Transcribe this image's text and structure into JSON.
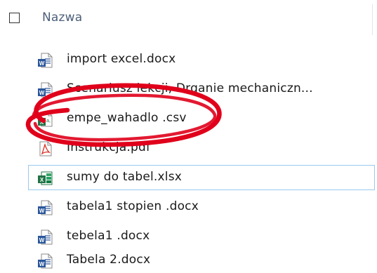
{
  "header": {
    "column_label": "Nazwa"
  },
  "files": [
    {
      "name": "import excel.docx",
      "icon": "word-document-icon",
      "type": "word"
    },
    {
      "name": "Scenariusz lekcji, Drganie mechaniczn...",
      "icon": "word-document-icon",
      "type": "word"
    },
    {
      "name": "empe_wahadlo .csv",
      "icon": "excel-csv-icon",
      "type": "csv"
    },
    {
      "name": "Instrukcja.pdf",
      "icon": "pdf-document-icon",
      "type": "pdf"
    },
    {
      "name": "sumy do tabel.xlsx",
      "icon": "excel-workbook-icon",
      "type": "excel",
      "selected": true
    },
    {
      "name": "tabela1 stopien .docx",
      "icon": "word-document-icon",
      "type": "word"
    },
    {
      "name": "tebela1 .docx",
      "icon": "word-document-icon",
      "type": "word"
    },
    {
      "name": "Tabela 2.docx",
      "icon": "word-document-icon",
      "type": "word"
    }
  ],
  "colors": {
    "word_blue": "#2b579a",
    "excel_green": "#217346",
    "pdf_red": "#d93025",
    "selection_border": "#99c9ef",
    "annotation_red": "#e0001b",
    "header_text": "#4c607a"
  }
}
